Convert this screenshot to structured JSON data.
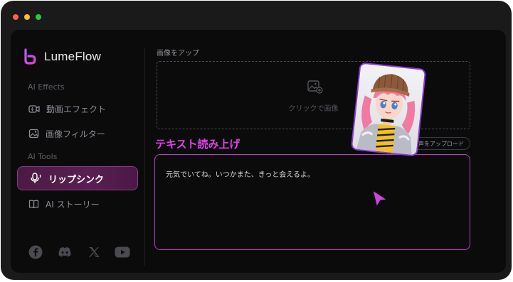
{
  "window": {
    "controls": [
      "close",
      "minimize",
      "maximize"
    ]
  },
  "app": {
    "name": "LumeFlow"
  },
  "sidebar": {
    "sections": [
      {
        "label": "AI Effects"
      },
      {
        "label": "AI Tools"
      }
    ],
    "items": [
      {
        "label": "動画エフェクト",
        "icon": "video-effect-icon"
      },
      {
        "label": "画像フィルター",
        "icon": "image-filter-icon"
      },
      {
        "label": "リップシンク",
        "icon": "lip-sync-icon",
        "active": true
      },
      {
        "label": "AI ストーリー",
        "icon": "ai-story-icon"
      }
    ],
    "social": [
      "facebook-icon",
      "discord-icon",
      "x-icon",
      "youtube-icon"
    ]
  },
  "upload": {
    "label": "画像をアップ",
    "drop_text": "クリックで画像"
  },
  "tts": {
    "title": "テキスト読み上げ",
    "audio_upload_label": "音声をアップロード",
    "text": "元気でいてね。いつかまた、きっと会えるよ。"
  },
  "colors": {
    "accent": "#e040e8",
    "active_item_bg": "#4f1b49",
    "textarea_border": "#b73fbe",
    "card_border": "#8d3bd6"
  }
}
